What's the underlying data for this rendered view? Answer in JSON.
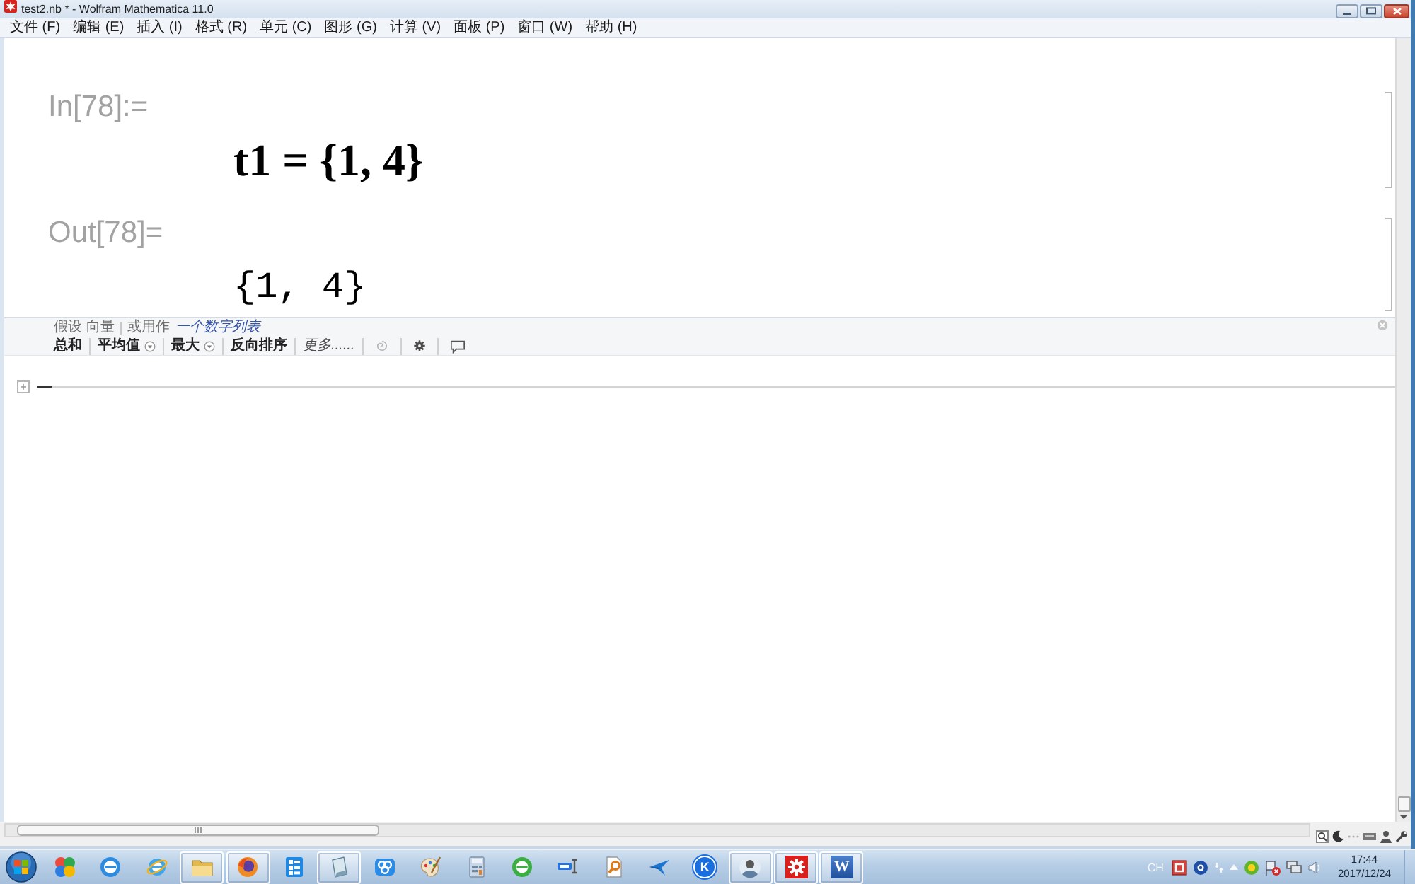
{
  "window": {
    "title": "test2.nb * - Wolfram Mathematica 11.0"
  },
  "menu": [
    "文件 (F)",
    "编辑 (E)",
    "插入 (I)",
    "格式 (R)",
    "单元 (C)",
    "图形 (G)",
    "计算 (V)",
    "面板 (P)",
    "窗口 (W)",
    "帮助 (H)"
  ],
  "notebook": {
    "cells": [
      {
        "kind": "input",
        "label": "In[78]:=",
        "content": "t1 = {1, 4}"
      },
      {
        "kind": "output",
        "label": "Out[78]=",
        "content": "{1, 4}"
      }
    ],
    "suggestions_bar": {
      "assumption": "假设 向量",
      "alternative_prefix": "或用作",
      "alternative": "一个数字列表",
      "actions": [
        {
          "kind": "plain",
          "label": "总和"
        },
        {
          "kind": "dropdown",
          "label": "平均值"
        },
        {
          "kind": "dropdown",
          "label": "最大"
        },
        {
          "kind": "plain",
          "label": "反向排序"
        },
        {
          "kind": "more",
          "label": "更多......"
        }
      ]
    }
  },
  "taskbar": {
    "apps": [
      {
        "running": false
      },
      {
        "running": false
      },
      {
        "running": false
      },
      {
        "running": true
      },
      {
        "running": true
      },
      {
        "running": false
      },
      {
        "running": true
      },
      {
        "running": false
      },
      {
        "running": false
      },
      {
        "running": false
      },
      {
        "running": false
      },
      {
        "running": false
      },
      {
        "running": false
      },
      {
        "running": false
      },
      {
        "running": false,
        "logo_text": "K"
      },
      {
        "running": true
      },
      {
        "running": true
      },
      {
        "running": true,
        "logo_text": "W"
      }
    ],
    "tray": {
      "language": "CH",
      "time": "17:44",
      "date": "2017/12/24"
    }
  }
}
